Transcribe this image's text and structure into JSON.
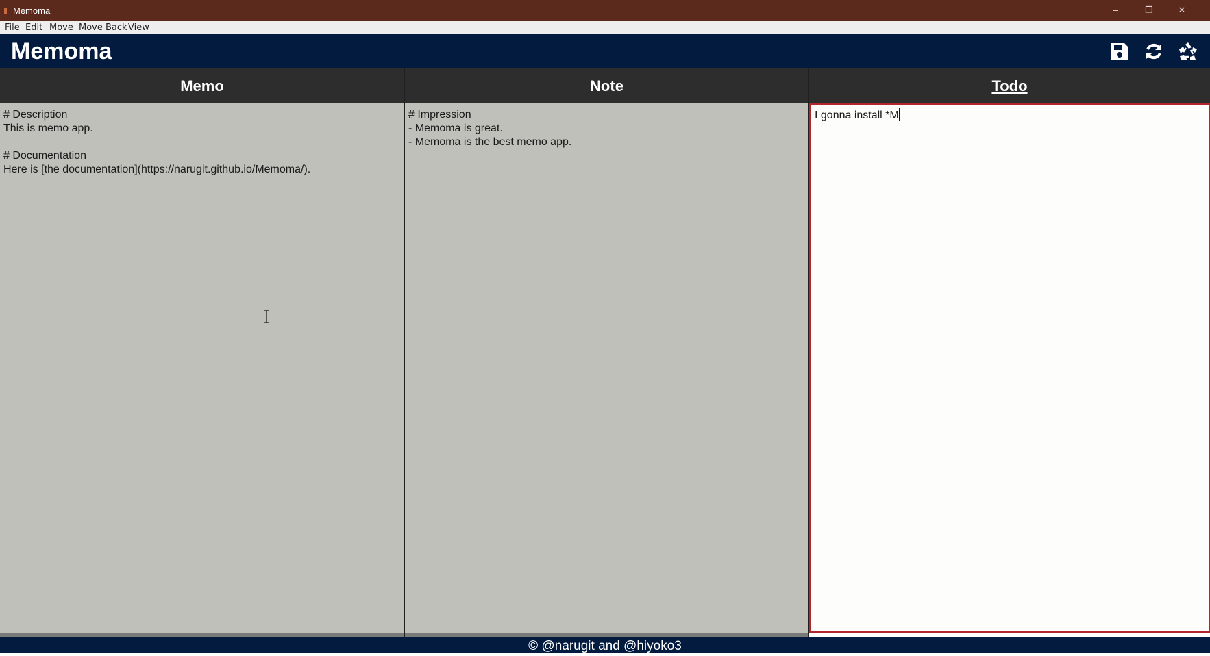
{
  "window": {
    "title": "Memoma",
    "controls": {
      "minimize": "–",
      "restore": "❐",
      "close": "✕"
    }
  },
  "menu": [
    "File",
    "Edit",
    "Move",
    "Move Back",
    "View"
  ],
  "header": {
    "brand": "Memoma",
    "tools": [
      "save-icon",
      "sync-icon",
      "recycle-icon"
    ]
  },
  "columns": {
    "memo": {
      "title": "Memo",
      "text": "# Description\nThis is memo app.\n\n# Documentation\nHere is [the documentation](https://narugit.github.io/Memoma/)."
    },
    "note": {
      "title": "Note",
      "text": "# Impression\n- Memoma is great.\n- Memoma is the best memo app."
    },
    "todo": {
      "title": "Todo",
      "text": "I gonna install *M",
      "active": true
    }
  },
  "footer": {
    "text": "© @narugit and @hiyoko3"
  },
  "colors": {
    "titlebar": "#5b2a1d",
    "appbar": "#031b3f",
    "column_header": "#2d2d2d",
    "pane": "#c0c0bb",
    "active_border": "#b2262c"
  }
}
